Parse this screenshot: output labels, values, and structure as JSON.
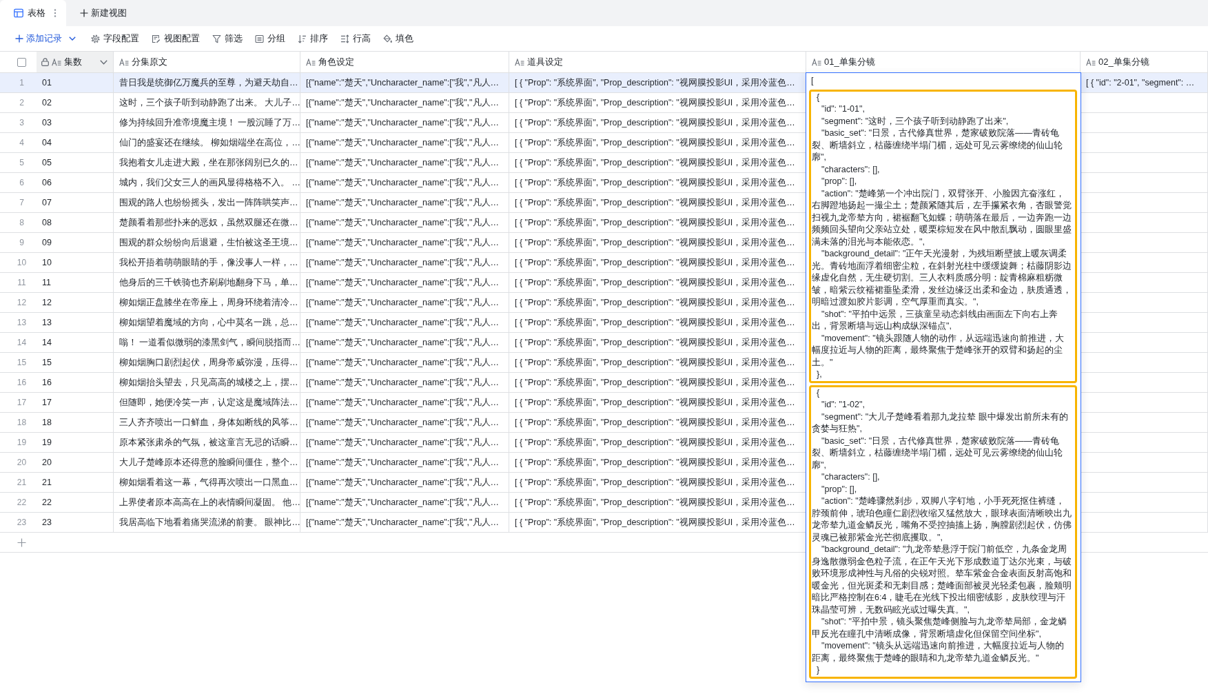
{
  "view_tabs": [
    {
      "label": "表格",
      "selected": true
    }
  ],
  "new_view_button": "新建视图",
  "toolbar": {
    "add_record": "添加记录",
    "actions": [
      {
        "kind": "settings",
        "label": "字段配置"
      },
      {
        "kind": "view",
        "label": "视图配置"
      },
      {
        "kind": "filter",
        "label": "筛选"
      },
      {
        "kind": "group",
        "label": "分组"
      },
      {
        "kind": "sort",
        "label": "排序"
      },
      {
        "kind": "row_height",
        "label": "行高"
      },
      {
        "kind": "fill",
        "label": "填色"
      }
    ]
  },
  "table": {
    "select_all_checked": false,
    "columns": [
      {
        "label": "集数",
        "locked": true
      },
      {
        "label": "分集原文",
        "locked": false
      },
      {
        "label": "角色设定",
        "locked": false
      },
      {
        "label": "道具设定",
        "locked": false
      },
      {
        "label": "01_单集分镜",
        "locked": false
      },
      {
        "label": "02_单集分镜",
        "locked": false
      }
    ],
    "rows": [
      {
        "number": "1",
        "selected": true,
        "episode": "01",
        "original_text": "昔日我是统御亿万魔兵的至尊，为避天劫自…",
        "roles": "[{\"name\":\"楚天\",\"Uncharacter_name\":[\"我\",\"凡人…",
        "props": "[ { \"Prop\": \"系统界面\", \"Prop_description\": \"视网膜投影UI，采用冷蓝色…",
        "storyboard_02": "[ { \"id\": \"2-01\", \"segment\": …"
      },
      {
        "number": "2",
        "selected": false,
        "episode": "02",
        "original_text": "这时，三个孩子听到动静跑了出来。 大儿子…",
        "roles": "[{\"name\":\"楚天\",\"Uncharacter_name\":[\"我\",\"凡人…",
        "props": "[ { \"Prop\": \"系统界面\", \"Prop_description\": \"视网膜投影UI，采用冷蓝色…"
      },
      {
        "number": "3",
        "selected": false,
        "episode": "03",
        "original_text": "修为持续回升准帝境魔主境！ 一股沉睡了万…",
        "roles": "[{\"name\":\"楚天\",\"Uncharacter_name\":[\"我\",\"凡人…",
        "props": "[ { \"Prop\": \"系统界面\", \"Prop_description\": \"视网膜投影UI，采用冷蓝色…"
      },
      {
        "number": "4",
        "selected": false,
        "episode": "04",
        "original_text": "仙门的盛宴还在继续。 柳如烟端坐在高位，…",
        "roles": "[{\"name\":\"楚天\",\"Uncharacter_name\":[\"我\",\"凡人…",
        "props": "[ { \"Prop\": \"系统界面\", \"Prop_description\": \"视网膜投影UI，采用冷蓝色…"
      },
      {
        "number": "5",
        "selected": false,
        "episode": "05",
        "original_text": "我抱着女儿走进大殿，坐在那张阔别已久的…",
        "roles": "[{\"name\":\"楚天\",\"Uncharacter_name\":[\"我\",\"凡人…",
        "props": "[ { \"Prop\": \"系统界面\", \"Prop_description\": \"视网膜投影UI，采用冷蓝色…"
      },
      {
        "number": "6",
        "selected": false,
        "episode": "06",
        "original_text": "城内，我们父女三人的画风显得格格不入。 …",
        "roles": "[{\"name\":\"楚天\",\"Uncharacter_name\":[\"我\",\"凡人…",
        "props": "[ { \"Prop\": \"系统界面\", \"Prop_description\": \"视网膜投影UI，采用冷蓝色…"
      },
      {
        "number": "7",
        "selected": false,
        "episode": "07",
        "original_text": "围观的路人也纷纷摇头，发出一阵阵哄笑声…",
        "roles": "[{\"name\":\"楚天\",\"Uncharacter_name\":[\"我\",\"凡人…",
        "props": "[ { \"Prop\": \"系统界面\", \"Prop_description\": \"视网膜投影UI，采用冷蓝色…"
      },
      {
        "number": "8",
        "selected": false,
        "episode": "08",
        "original_text": "楚颜看着那些扑来的恶奴，虽然双腿还在微…",
        "roles": "[{\"name\":\"楚天\",\"Uncharacter_name\":[\"我\",\"凡人…",
        "props": "[ { \"Prop\": \"系统界面\", \"Prop_description\": \"视网膜投影UI，采用冷蓝色…"
      },
      {
        "number": "9",
        "selected": false,
        "episode": "09",
        "original_text": "围观的群众纷纷向后退避，生怕被这圣王境…",
        "roles": "[{\"name\":\"楚天\",\"Uncharacter_name\":[\"我\",\"凡人…",
        "props": "[ { \"Prop\": \"系统界面\", \"Prop_description\": \"视网膜投影UI，采用冷蓝色…"
      },
      {
        "number": "10",
        "selected": false,
        "episode": "10",
        "original_text": "我松开捂着萌萌眼睛的手，像没事人一样，…",
        "roles": "[{\"name\":\"楚天\",\"Uncharacter_name\":[\"我\",\"凡人…",
        "props": "[ { \"Prop\": \"系统界面\", \"Prop_description\": \"视网膜投影UI，采用冷蓝色…"
      },
      {
        "number": "11",
        "selected": false,
        "episode": "11",
        "original_text": "他身后的三千铁骑也齐刷刷地翻身下马，单…",
        "roles": "[{\"name\":\"楚天\",\"Uncharacter_name\":[\"我\",\"凡人…",
        "props": "[ { \"Prop\": \"系统界面\", \"Prop_description\": \"视网膜投影UI，采用冷蓝色…"
      },
      {
        "number": "12",
        "selected": false,
        "episode": "12",
        "original_text": "柳如烟正盘膝坐在帝座上，周身环绕着清冷…",
        "roles": "[{\"name\":\"楚天\",\"Uncharacter_name\":[\"我\",\"凡人…",
        "props": "[ { \"Prop\": \"系统界面\", \"Prop_description\": \"视网膜投影UI，采用冷蓝色…"
      },
      {
        "number": "13",
        "selected": false,
        "episode": "13",
        "original_text": "柳如烟望着魔域的方向，心中莫名一跳，总…",
        "roles": "[{\"name\":\"楚天\",\"Uncharacter_name\":[\"我\",\"凡人…",
        "props": "[ { \"Prop\": \"系统界面\", \"Prop_description\": \"视网膜投影UI，采用冷蓝色…"
      },
      {
        "number": "14",
        "selected": false,
        "episode": "14",
        "original_text": "嗡！ 一道看似微弱的漆黑剑气，瞬间脱指而…",
        "roles": "[{\"name\":\"楚天\",\"Uncharacter_name\":[\"我\",\"凡人…",
        "props": "[ { \"Prop\": \"系统界面\", \"Prop_description\": \"视网膜投影UI，采用冷蓝色…"
      },
      {
        "number": "15",
        "selected": false,
        "episode": "15",
        "original_text": "柳如烟胸口剧烈起伏，周身帝威弥漫，压得…",
        "roles": "[{\"name\":\"楚天\",\"Uncharacter_name\":[\"我\",\"凡人…",
        "props": "[ { \"Prop\": \"系统界面\", \"Prop_description\": \"视网膜投影UI，采用冷蓝色…"
      },
      {
        "number": "16",
        "selected": false,
        "episode": "16",
        "original_text": "柳如烟抬头望去，只见高高的城楼之上，摆…",
        "roles": "[{\"name\":\"楚天\",\"Uncharacter_name\":[\"我\",\"凡人…",
        "props": "[ { \"Prop\": \"系统界面\", \"Prop_description\": \"视网膜投影UI，采用冷蓝色…"
      },
      {
        "number": "17",
        "selected": false,
        "episode": "17",
        "original_text": "但随即，她便冷笑一声，认定这是魔域阵法…",
        "roles": "[{\"name\":\"楚天\",\"Uncharacter_name\":[\"我\",\"凡人…",
        "props": "[ { \"Prop\": \"系统界面\", \"Prop_description\": \"视网膜投影UI，采用冷蓝色…"
      },
      {
        "number": "18",
        "selected": false,
        "episode": "18",
        "original_text": "三人齐齐喷出一口鲜血，身体如断线的风筝…",
        "roles": "[{\"name\":\"楚天\",\"Uncharacter_name\":[\"我\",\"凡人…",
        "props": "[ { \"Prop\": \"系统界面\", \"Prop_description\": \"视网膜投影UI，采用冷蓝色…"
      },
      {
        "number": "19",
        "selected": false,
        "episode": "19",
        "original_text": "原本紧张肃杀的气氛，被这童言无忌的话瞬…",
        "roles": "[{\"name\":\"楚天\",\"Uncharacter_name\":[\"我\",\"凡人…",
        "props": "[ { \"Prop\": \"系统界面\", \"Prop_description\": \"视网膜投影UI，采用冷蓝色…"
      },
      {
        "number": "20",
        "selected": false,
        "episode": "20",
        "original_text": "大儿子楚峰原本还得意的脸瞬间僵住，整个…",
        "roles": "[{\"name\":\"楚天\",\"Uncharacter_name\":[\"我\",\"凡人…",
        "props": "[ { \"Prop\": \"系统界面\", \"Prop_description\": \"视网膜投影UI，采用冷蓝色…"
      },
      {
        "number": "21",
        "selected": false,
        "episode": "21",
        "original_text": "柳如烟看着这一幕，气得再次喷出一口黑血…",
        "roles": "[{\"name\":\"楚天\",\"Uncharacter_name\":[\"我\",\"凡人…",
        "props": "[ { \"Prop\": \"系统界面\", \"Prop_description\": \"视网膜投影UI，采用冷蓝色…"
      },
      {
        "number": "22",
        "selected": false,
        "episode": "22",
        "original_text": "上界使者原本高高在上的表情瞬间凝固。 他…",
        "roles": "[{\"name\":\"楚天\",\"Uncharacter_name\":[\"我\",\"凡人…",
        "props": "[ { \"Prop\": \"系统界面\", \"Prop_description\": \"视网膜投影UI，采用冷蓝色…"
      },
      {
        "number": "23",
        "selected": false,
        "episode": "23",
        "original_text": "我居高临下地看着痛哭流涕的前妻。 眼神比…",
        "roles": "[{\"name\":\"楚天\",\"Uncharacter_name\":[\"我\",\"凡人…",
        "props": "[ { \"Prop\": \"系统界面\", \"Prop_description\": \"视网膜投影UI，采用冷蓝色…"
      }
    ]
  },
  "expanded_cell": {
    "opening": "[",
    "entries": [
      {
        "highlighted": true,
        "open": "{",
        "fields": [
          "\"id\": \"1-01\",",
          "\"segment\": \"这时，三个孩子听到动静跑了出来\",",
          "\"basic_set\": \"日景，古代修真世界，楚家破败院落——青砖龟裂、断墙斜立，枯藤缠绕半塌门楣，远处可见云雾缭绕的仙山轮廓\",",
          "\"characters\": [],",
          "\"prop\": [],",
          "\"action\": \"楚峰第一个冲出院门，双臂张开、小脸因亢奋涨红，右脚蹬地扬起一撮尘土；楚颜紧随其后，左手攥紧衣角，杏眼警觉扫视九龙帝辇方向，裙裾翻飞如蝶；萌萌落在最后，一边奔跑一边频频回头望向父亲站立处，暖栗棕短发在风中散乱飘动，圆眼里盛满未落的泪光与本能依恋。\",",
          "\"background_detail\": \"正午天光漫射，为残垣断壁披上暖灰调柔光。青砖地面浮着细密尘粒，在斜射光柱中缓缓旋舞；枯藤阴影边缘虚化自然，无生硬切割。三人衣料质感分明：靛青棉麻粗粝微皱，暗紫云纹襦裙垂坠柔滑，发丝边缘泛出柔和金边，肤质通透，明暗过渡如胶片影调，空气厚重而真实。\",",
          "\"shot\": \"平拍中远景，三孩童呈动态斜线由画面左下向右上奔出，背景断墙与远山构成纵深锚点\",",
          "\"movement\": \"镜头跟随人物的动作，从远端迅速向前推进，大幅度拉近与人物的距离，最终聚焦于楚峰张开的双臂和扬起的尘土。\""
        ],
        "close": "},"
      },
      {
        "highlighted": true,
        "open": "{",
        "fields": [
          "\"id\": \"1-02\",",
          "\"segment\": \"大儿子楚峰看着那九龙拉辇 眼中爆发出前所未有的贪婪与狂热\",",
          "\"basic_set\": \"日景，古代修真世界，楚家破败院落——青砖龟裂、断墙斜立，枯藤缠绕半塌门楣，远处可见云雾缭绕的仙山轮廓\",",
          "\"characters\": [],",
          "\"prop\": [],",
          "\"action\": \"楚峰骤然刹步，双脚八字钉地，小手死死抠住裤缝，脖颈前伸，琥珀色瞳仁剧烈收缩又猛然放大，眼球表面清晰映出九龙帝辇九道金鳞反光，嘴角不受控抽搐上扬，胸膛剧烈起伏，仿佛灵魂已被那紫金光芒彻底攫取。\",",
          "\"background_detail\": \"九龙帝辇悬浮于院门前低空，九条金龙周身逸散微弱金色粒子流，在正午天光下形成数道丁达尔光束，与破败环境形成神性与凡俗的尖锐对照。辇车紫金合金表面反射高饱和暖金光，但光斑柔和无刺目感；楚峰面部被灵光轻柔包裹，脸颊明暗比严格控制在6:4，睫毛在光线下投出细密绒影，皮肤纹理与汗珠晶莹可辨，无数码眩光或过曝失真。\",",
          "\"shot\": \"平拍中景，镜头聚焦楚峰侧脸与九龙帝辇局部，金龙鳞甲反光在瞳孔中清晰成像，背景断墙虚化但保留空间坐标\",",
          "\"movement\": \"镜头从远端迅速向前推进，大幅度拉近与人物的距离，最终聚焦于楚峰的眼睛和九龙帝辇九道金鳞反光。\""
        ],
        "close": "}"
      }
    ]
  }
}
